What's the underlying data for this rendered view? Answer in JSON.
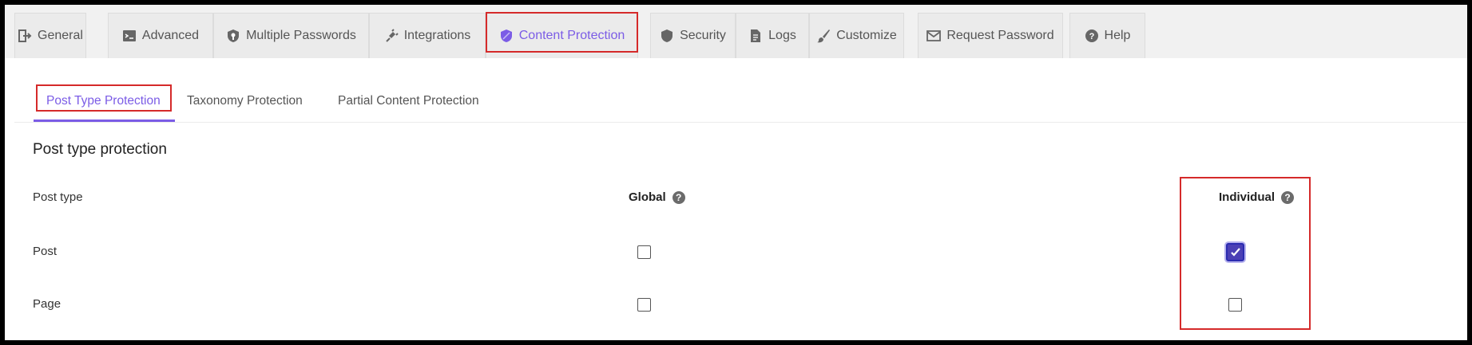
{
  "tabs": [
    {
      "label": "General",
      "icon": "logout-icon"
    },
    {
      "label": "Advanced",
      "icon": "terminal-icon"
    },
    {
      "label": "Multiple Passwords",
      "icon": "shield-key-icon"
    },
    {
      "label": "Integrations",
      "icon": "plug-icon"
    },
    {
      "label": "Content Protection",
      "icon": "shield-icon",
      "active": true
    },
    {
      "label": "Security",
      "icon": "shield-icon"
    },
    {
      "label": "Logs",
      "icon": "document-icon"
    },
    {
      "label": "Customize",
      "icon": "brush-icon"
    },
    {
      "label": "Request Password",
      "icon": "envelope-icon"
    },
    {
      "label": "Help",
      "icon": "question-icon"
    }
  ],
  "subtabs": [
    {
      "label": "Post Type Protection",
      "active": true
    },
    {
      "label": "Taxonomy Protection"
    },
    {
      "label": "Partial Content Protection"
    }
  ],
  "section": {
    "title": "Post type protection",
    "columns": {
      "post_type": "Post type",
      "global": "Global",
      "individual": "Individual"
    },
    "rows": [
      {
        "label": "Post",
        "global": false,
        "individual": true
      },
      {
        "label": "Page",
        "global": false,
        "individual": false
      }
    ]
  },
  "colors": {
    "accent": "#7b5ce6",
    "highlight": "#d52a2a",
    "checkbox_checked": "#4a3fb5"
  }
}
